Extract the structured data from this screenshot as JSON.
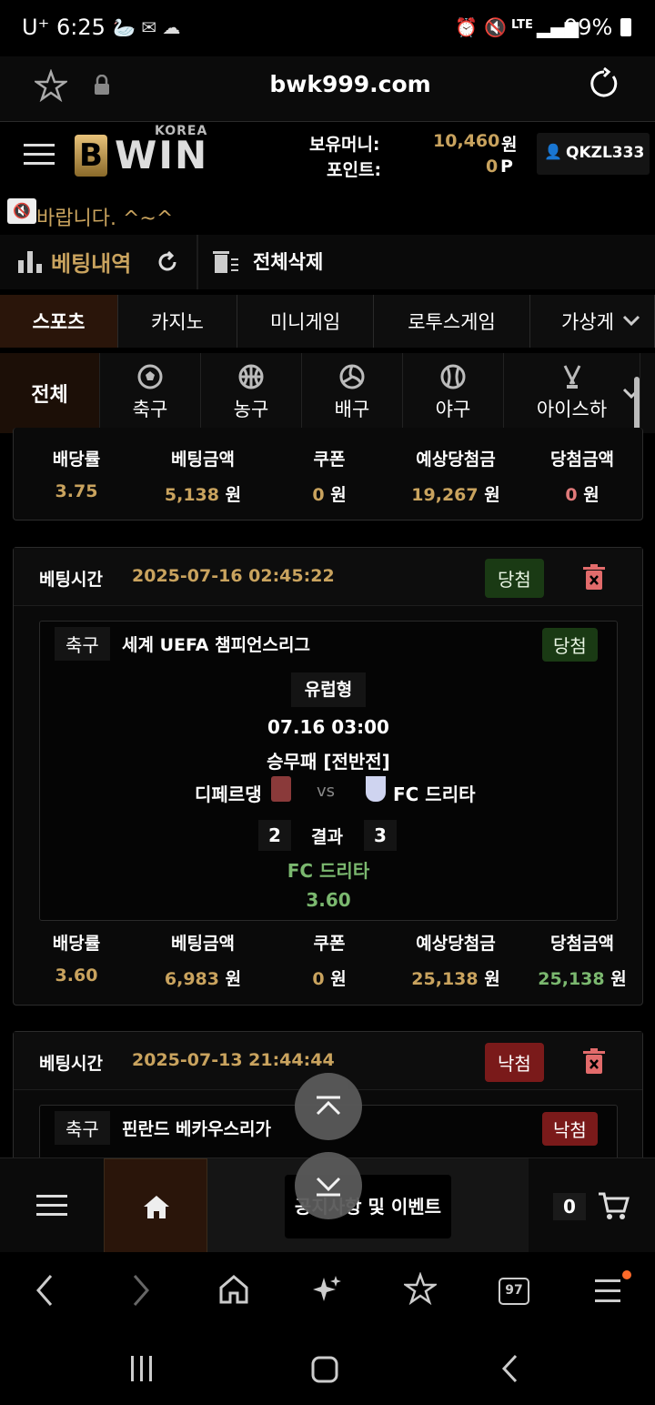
{
  "status": {
    "carrier": "U⁺",
    "time": "6:25",
    "network": "LTE",
    "battery": "99%"
  },
  "browser": {
    "url": "bwk999.com"
  },
  "header": {
    "logo_top": "KOREA",
    "logo_main": "WIN",
    "money_label": "보유머니:",
    "money_value": "10,460",
    "money_unit": "원",
    "point_label": "포인트:",
    "point_value": "0",
    "point_unit": "P",
    "user": "QKZL333"
  },
  "notice": {
    "text": "바랍니다. ^~^"
  },
  "section": {
    "title": "베팅내역",
    "delete_all": "전체삭제"
  },
  "tabs": [
    "스포츠",
    "카지노",
    "미니게임",
    "로투스게임",
    "가상게"
  ],
  "sports": {
    "all": "전체",
    "items": [
      "축구",
      "농구",
      "배구",
      "야구",
      "아이스하"
    ]
  },
  "stat_labels": [
    "배당률",
    "베팅금액",
    "쿠폰",
    "예상당첨금",
    "당첨금액"
  ],
  "unit": "원",
  "bet0": {
    "stats": [
      "3.75",
      "5,138",
      "0",
      "19,267",
      "0"
    ]
  },
  "bet1": {
    "time_label": "베팅시간",
    "time": "2025-07-16 02:45:22",
    "status": "당첨",
    "sport": "축구",
    "league": "세계 UEFA 챔피언스리그",
    "item_status": "당첨",
    "type": "유럽형",
    "match_time": "07.16 03:00",
    "market": "승무패 [전반전]",
    "home": "디페르댕",
    "vs": "vs",
    "away": "FC 드리타",
    "home_score": "2",
    "result_label": "결과",
    "away_score": "3",
    "pick": "FC 드리타",
    "pick_odds": "3.60",
    "stats": [
      "3.60",
      "6,983",
      "0",
      "25,138",
      "25,138"
    ]
  },
  "bet2": {
    "time_label": "베팅시간",
    "time": "2025-07-13 21:44:44",
    "status": "낙첨",
    "sport": "축구",
    "league": "핀란드 베카우스리가",
    "item_status": "낙첨"
  },
  "bottom": {
    "event_label": "공지사항 및 이벤트",
    "cart_count": "0"
  }
}
